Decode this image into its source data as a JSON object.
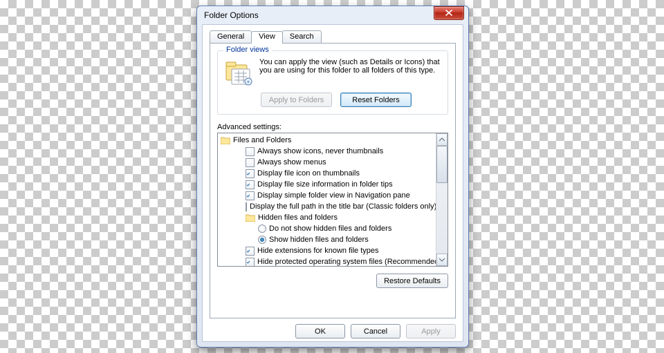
{
  "title": "Folder Options",
  "tabs": {
    "general": "General",
    "view": "View",
    "search": "Search"
  },
  "folderViews": {
    "legend": "Folder views",
    "text": "You can apply the view (such as Details or Icons) that you are using for this folder to all folders of this type.",
    "applyBtn": "Apply to Folders",
    "resetBtn": "Reset Folders"
  },
  "advancedLabel": "Advanced settings:",
  "tree": {
    "root": "Files and Folders",
    "items": [
      {
        "kind": "check",
        "checked": false,
        "label": "Always show icons, never thumbnails"
      },
      {
        "kind": "check",
        "checked": false,
        "label": "Always show menus"
      },
      {
        "kind": "check",
        "checked": true,
        "label": "Display file icon on thumbnails"
      },
      {
        "kind": "check",
        "checked": true,
        "label": "Display file size information in folder tips"
      },
      {
        "kind": "check",
        "checked": true,
        "label": "Display simple folder view in Navigation pane"
      },
      {
        "kind": "check",
        "checked": false,
        "label": "Display the full path in the title bar (Classic folders only)"
      },
      {
        "kind": "folder",
        "label": "Hidden files and folders"
      },
      {
        "kind": "radio",
        "checked": false,
        "label": "Do not show hidden files and folders",
        "indent": 3
      },
      {
        "kind": "radio",
        "checked": true,
        "label": "Show hidden files and folders",
        "indent": 3
      },
      {
        "kind": "check",
        "checked": true,
        "label": "Hide extensions for known file types"
      },
      {
        "kind": "check",
        "checked": true,
        "label": "Hide protected operating system files (Recommended)"
      }
    ]
  },
  "restoreBtn": "Restore Defaults",
  "ok": "OK",
  "cancel": "Cancel",
  "apply": "Apply"
}
